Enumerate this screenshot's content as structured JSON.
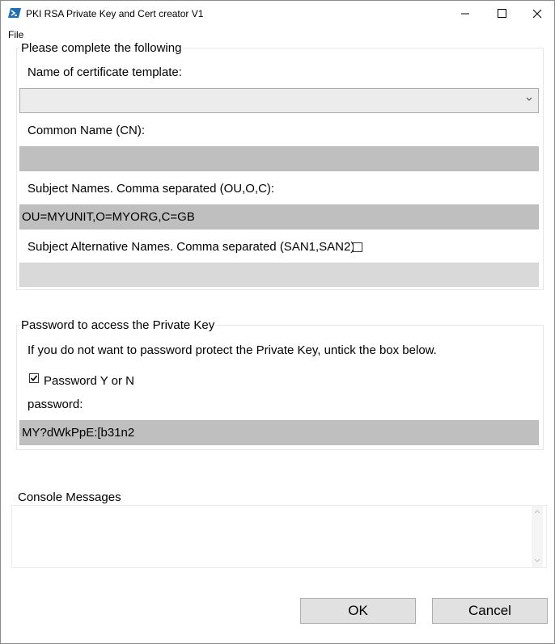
{
  "window": {
    "title": "PKI RSA Private Key and Cert creator V1",
    "minimize_icon": "minimize-icon",
    "maximize_icon": "maximize-icon",
    "close_icon": "close-icon"
  },
  "menu": {
    "file": "File"
  },
  "certificate_group": {
    "legend": "Please complete the following",
    "template_label": "Name of certificate template:",
    "template_value": "",
    "cn_label": "Common Name (CN):",
    "cn_value": "",
    "subject_label": "Subject Names. Comma separated (OU,O,C):",
    "subject_value": "OU=MYUNIT,O=MYORG,C=GB",
    "san_label": "Subject Alternative Names. Comma separated (SAN1,SAN2):",
    "san_checked": false,
    "san_value": ""
  },
  "password_group": {
    "legend": "Password to access the Private Key",
    "info": "If you do not want to password protect the Private Key, untick the box below.",
    "checkbox_label": "Password Y or N",
    "checked": true,
    "password_label": "password:",
    "password_value": "MY?dWkPpE:[b31n2"
  },
  "console": {
    "label": "Console Messages",
    "text": ""
  },
  "buttons": {
    "ok": "OK",
    "cancel": "Cancel"
  },
  "colors": {
    "field_bg": "#bfbfbf",
    "field_disabled_bg": "#d9d9d9",
    "button_bg": "#e1e1e1",
    "app_icon": "#1f6fb5"
  }
}
